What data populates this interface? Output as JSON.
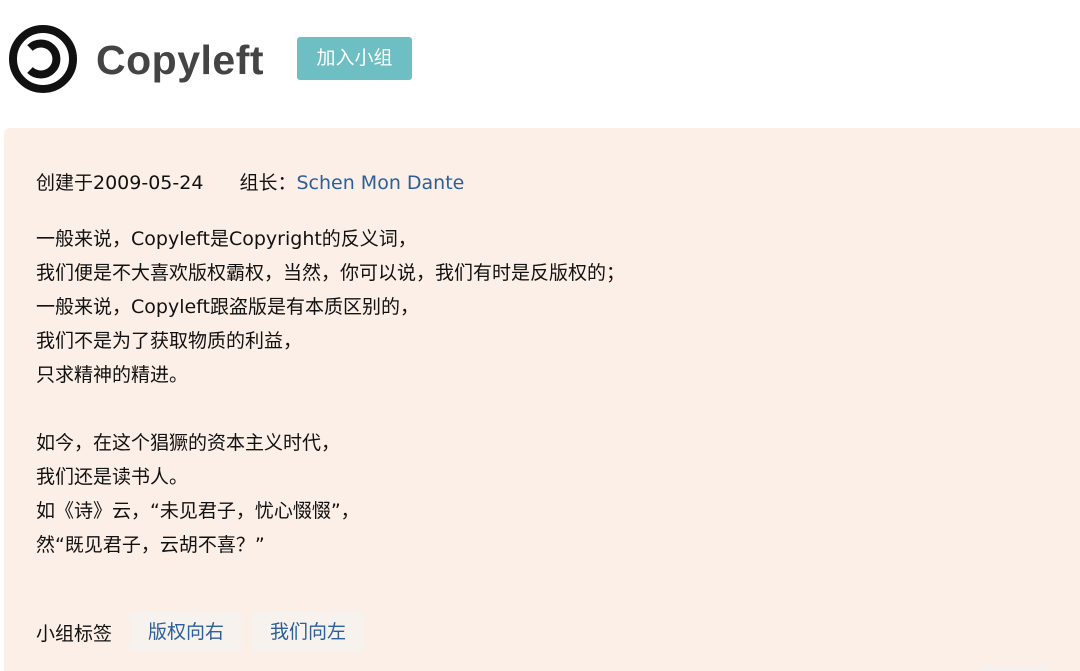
{
  "header": {
    "group_name": "Copyleft",
    "join_button": "加入小组",
    "logo_icon": "copyleft-icon"
  },
  "info": {
    "created_text": "创建于2009-05-24",
    "owner_label": "组长：",
    "owner_name": "Schen Mon Dante"
  },
  "intro": {
    "paragraph1": [
      "一般来说，Copyleft是Copyright的反义词，",
      "我们便是不大喜欢版权霸权，当然，你可以说，我们有时是反版权的；",
      "一般来说，Copyleft跟盗版是有本质区别的，",
      "我们不是为了获取物质的利益，",
      "只求精神的精进。"
    ],
    "paragraph2": [
      "如今，在这个猖獗的资本主义时代，",
      "我们还是读书人。",
      "如《诗》云，“未见君子，忧心惙惙”，",
      "然“既见君子，云胡不喜？”"
    ]
  },
  "tags": {
    "label": "小组标签",
    "items": [
      "版权向右",
      "我们向左"
    ]
  },
  "colors": {
    "card_bg": "#fcefe7",
    "join_button_bg": "#6ebfc3",
    "link": "#2c5f9a"
  }
}
